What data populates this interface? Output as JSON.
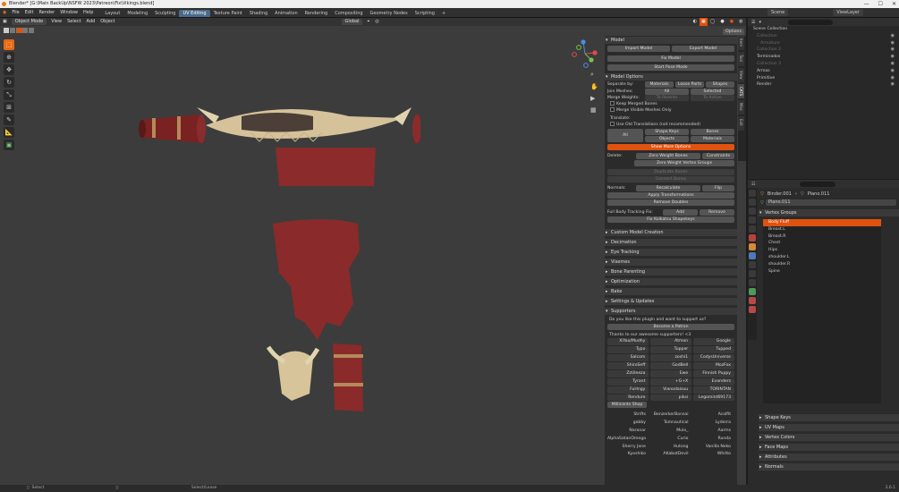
{
  "window": {
    "title": "Blender* [G:\\Main BackUp\\NSFW 2023\\Patreon\\Fix\\Vikings.blend]",
    "controls": [
      "—",
      "☐",
      "✕"
    ]
  },
  "menu": [
    "File",
    "Edit",
    "Render",
    "Window",
    "Help"
  ],
  "workspaces": [
    "Layout",
    "Modeling",
    "Sculpting",
    "UV Editing",
    "Texture Paint",
    "Shading",
    "Animation",
    "Rendering",
    "Compositing",
    "Geometry Nodes",
    "Scripting"
  ],
  "active_workspace": "UV Editing",
  "scene": {
    "label": "Scene",
    "viewlayer": "ViewLayer"
  },
  "viewport_header": {
    "mode": "Object Mode",
    "menus": [
      "View",
      "Select",
      "Add",
      "Object"
    ],
    "orientation": "Global",
    "options": "Options"
  },
  "tools": [
    "select-tool",
    "cursor-tool",
    "move-tool",
    "rotate-tool",
    "scale-tool",
    "transform-tool",
    "annotate-tool",
    "measure-tool",
    "add-cube-tool"
  ],
  "npanel_tabs": [
    "Item",
    "Tool",
    "View",
    "CATS",
    "Misc",
    "Edit"
  ],
  "model_section": {
    "title": "Model",
    "import": "Import Model",
    "export": "Export Model",
    "fix": "Fix Model",
    "pose": "Start Pose Mode"
  },
  "model_options": {
    "title": "Model Options",
    "separate_by": "Separate by:",
    "sep_buttons": [
      "Materials",
      "Loose Parts",
      "Shapes"
    ],
    "join_meshes": "Join Meshes:",
    "join_buttons": [
      "All",
      "Selected"
    ],
    "merge_weights": "Merge Weights:",
    "merge_buttons": [
      "To Parents",
      "To Active"
    ],
    "checks": [
      "Keep Merged Bones",
      "Merge Visible Meshes Only"
    ],
    "translate": "Translate:",
    "use_old": "Use Old Translations (not recommended)",
    "all": "All",
    "trans_buttons": [
      "Shape Keys",
      "Bones",
      "Objects",
      "Materials"
    ],
    "show_more": "Show More Options",
    "delete": "Delete:",
    "del_buttons": [
      "Zero Weight Bones",
      "Constraints"
    ],
    "zero_vg": "Zero Weight Vertex Groups",
    "dup_bones": "Duplicate Bones",
    "connect_bones": "Connect Bones",
    "normals": "Normals:",
    "normals_buttons": [
      "Recalculate",
      "Flip"
    ],
    "apply_transforms": "Apply Transformations",
    "remove_doubles": "Remove Doubles",
    "fbt": "Full Body Tracking Fix:",
    "fbt_buttons": [
      "Add",
      "Remove"
    ],
    "fix_koikatsu": "Fix Koikatsu Shapekeys"
  },
  "collapsed_sections": [
    "Custom Model Creation",
    "Decimation",
    "Eye Tracking",
    "Visemes",
    "Bone Parenting",
    "Optimization",
    "Bake",
    "Settings & Updates"
  ],
  "supporters": {
    "title": "Supporters",
    "question": "Do you like this plugin and want to support us?",
    "become": "Become a Patron",
    "thanks": "Thanks to our awesome supporters! <3",
    "names": [
      "XiYao/Mudhy",
      "Atmon",
      "Google",
      "Typo",
      "Tupper",
      "Tupped",
      "Salcom",
      "zoshi1",
      "CodysUniverse",
      "ShiroSeff",
      "GodBell",
      "MozFox",
      "ZzUleeza",
      "Ewe",
      "Finnish Puppy",
      "Tyrant",
      "+G+X",
      "Evanders",
      "FuHngy",
      "Vianodaisuu",
      "TORINTAN",
      "Rendure",
      "piksi",
      "Legomint69173"
    ],
    "millicent": "Millicents Shop",
    "names2": [
      "Strifts",
      "BenzerkerBonsai",
      "Acolfit",
      "gobby",
      "Tomnautical",
      "Lyderra",
      "Naranar",
      "Mulo_",
      "Aarms",
      "AlphaSatanOmega",
      "Curio",
      "Runda",
      "Sherry Jane",
      "Hutong",
      "Vanilla Neko",
      "Kyoshiko",
      "AKabotDevil",
      "Whitto"
    ]
  },
  "outliner": {
    "title": "Scene Collection",
    "rows": [
      "Collection",
      "Armature",
      "Collection 2",
      "Terminados",
      "Collection 3",
      "Armas",
      "Primitive",
      "Render"
    ]
  },
  "properties": {
    "breadcrumb_obj": "Binder.001",
    "breadcrumb_mesh": "Plano.011",
    "data_name": "Plano.011",
    "vertex_groups_title": "Vertex Groups",
    "vertex_groups": [
      "Body Fluff",
      "Breast.L",
      "Breast.R",
      "Chest",
      "Hips",
      "shoulder.L",
      "shoulder.R",
      "Spine"
    ],
    "collapsed": [
      "Shape Keys",
      "UV Maps",
      "Vertex Colors",
      "Face Maps",
      "Attributes",
      "Normals"
    ]
  },
  "status": {
    "left": "Select",
    "middle": "Select/Loose",
    "version": "3.6.1"
  },
  "colors": {
    "accent": "#e0520f",
    "tab_active": "#4b6a8c",
    "background": "#3c3c3c"
  }
}
